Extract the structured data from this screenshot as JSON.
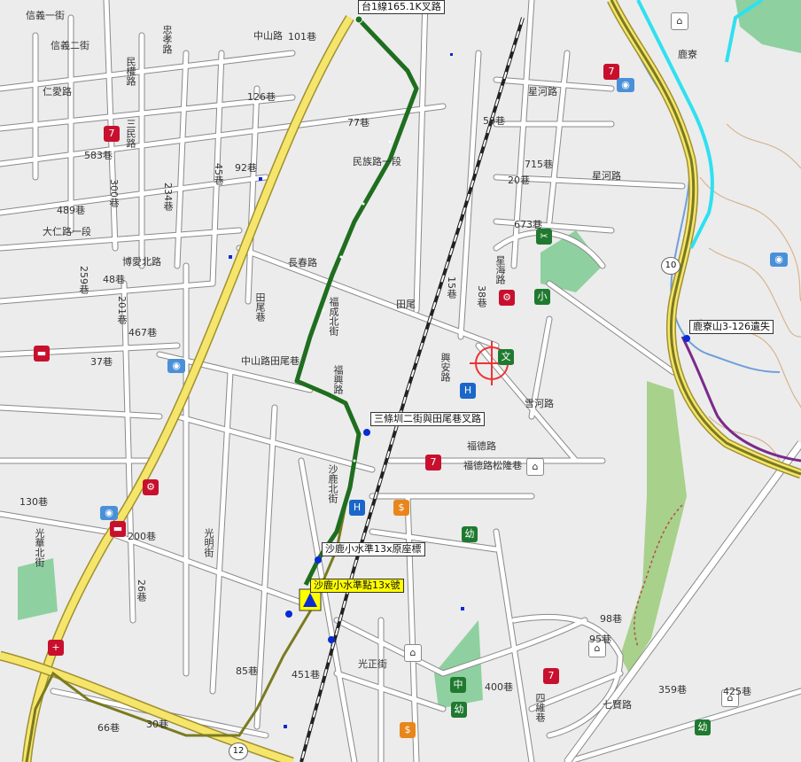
{
  "callouts": [
    {
      "id": "c1",
      "text": "台1線165.1K叉路"
    },
    {
      "id": "c2",
      "text": "三條圳二街與田尾巷叉路"
    },
    {
      "id": "c3",
      "text": "沙鹿小水準13x原座標"
    },
    {
      "id": "c4",
      "text": "沙鹿小水準點13x號"
    },
    {
      "id": "c5",
      "text": "鹿寮山3-126遺失"
    }
  ],
  "streets": [
    "信義一街",
    "信義二街",
    "仁愛路",
    "忠孝路",
    "民權路",
    "三民路",
    "101巷",
    "126巷",
    "77巷",
    "中山路",
    "民族路一段",
    "583巷",
    "92巷",
    "45巷",
    "300巷",
    "234巷",
    "489巷",
    "大仁路一段",
    "博愛北路",
    "48巷",
    "259巷",
    "201巷",
    "467巷",
    "37巷",
    "長春路",
    "田尾",
    "15巷",
    "38巷",
    "中山路田尾巷",
    "福成北街",
    "福興路",
    "田尾巷",
    "星河路",
    "興安路",
    "星海路",
    "星河路",
    "673巷",
    "715巷",
    "20巷",
    "59巷",
    "福德路",
    "福德路松隆巷",
    "沙鹿北街",
    "光華北街",
    "200巷",
    "130巷",
    "26巷",
    "光明街",
    "85巷",
    "451巷",
    "光正街",
    "66巷",
    "30巷",
    "98巷",
    "95巷",
    "359巷",
    "425巷",
    "七賢路",
    "400巷",
    "四維巷",
    "鹿寮",
    "台1線",
    "10",
    "12",
    "雪河路"
  ],
  "shields": [
    "10",
    "12"
  ],
  "poi_labels": [
    "小",
    "幼",
    "幼",
    "中",
    "幼",
    "文"
  ],
  "colors": {
    "background": "#ececec",
    "road": "#ffffff",
    "road_outline": "#8a8a8a",
    "highway": "#f5e56b",
    "highway_outline": "#a09030",
    "route": "#1f6e1f",
    "railway": "#222222",
    "river": "#6fa0d8",
    "cyan_route": "#2fe0f0",
    "purple_route": "#7a2a8a",
    "green_area": "#8fd0a0",
    "green_area2": "#9ccc7a",
    "brown_contour": "#d8b490"
  }
}
